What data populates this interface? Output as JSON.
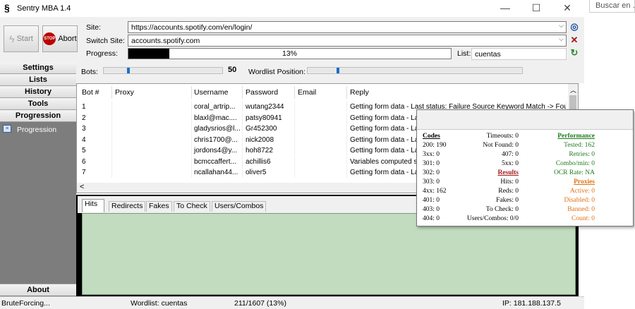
{
  "window": {
    "title": "Sentry MBA 1.4",
    "minimize": "—",
    "maximize": "☐",
    "close": "✕"
  },
  "external": {
    "search_placeholder": "Buscar en ..."
  },
  "toolbar": {
    "start_label": "Start",
    "abort_label": "Abort",
    "stop_badge": "STOP"
  },
  "site": {
    "label": "Site:",
    "value": "https://accounts.spotify.com/en/login/"
  },
  "switch_site": {
    "label": "Switch Site:",
    "value": "accounts.spotify.com"
  },
  "progress": {
    "label": "Progress:",
    "percent": 13,
    "text": "13%"
  },
  "list": {
    "label": "List:",
    "value": "cuentas"
  },
  "nav": {
    "items": [
      "Settings",
      "Lists",
      "History",
      "Tools",
      "Progression"
    ],
    "sub_item": "Progression",
    "about": "About"
  },
  "bots": {
    "label": "Bots:",
    "value": "50",
    "wordlist_label": "Wordlist Position:"
  },
  "table": {
    "headers": [
      "Bot #",
      "Proxy",
      "Username",
      "Password",
      "Email",
      "Reply"
    ],
    "rows": [
      [
        "1",
        "",
        "coral_artrip...",
        "wutang2344",
        "",
        "Getting form data - Last status: Failure Source Keyword Match -> Foun"
      ],
      [
        "2",
        "",
        "blaxl@mac....",
        "patsy80941",
        "",
        "Getting form data - La"
      ],
      [
        "3",
        "",
        "gladysrios@l...",
        "Gr452300",
        "",
        "Getting form data - La"
      ],
      [
        "4",
        "",
        "chris1700@...",
        "nick2008",
        "",
        "Getting form data - La"
      ],
      [
        "5",
        "",
        "jordons4@y...",
        "hoh8722",
        "",
        "Getting form data - La"
      ],
      [
        "6",
        "",
        "bcmccaffert...",
        "achillis6",
        "",
        "Variables computed s"
      ],
      [
        "7",
        "",
        "ncallahan44...",
        "oliver5",
        "",
        "Getting form data - La"
      ]
    ]
  },
  "tabs": [
    "Hits",
    "Redirects",
    "Fakes",
    "To Check",
    "Users/Combos"
  ],
  "status": {
    "state": "BruteForcing...",
    "wordlist": "Wordlist: cuentas",
    "count": "211/1607 (13%)",
    "ip": "IP: 181.188.137.5"
  },
  "popup": {
    "codes_title": "Codes",
    "codes": [
      "200: 190",
      "3xx: 0",
      "301: 0",
      "302: 0",
      "303: 0",
      "4xx: 162",
      "401: 0",
      "403: 0",
      "404: 0"
    ],
    "mid_top": [
      "Timeouts: 0",
      "Not Found: 0",
      "407: 0",
      "5xx: 0"
    ],
    "results_title": "Results",
    "results": [
      "Hits: 0",
      "Reds: 0",
      "Fakes: 0",
      "To Check: 0",
      "Users/Combos: 0/0"
    ],
    "performance_title": "Performance",
    "performance": [
      "Tested: 162",
      "Retries: 0",
      "Combo/min: 0",
      "OCR Rate: NA"
    ],
    "proxies_title": "Proxies",
    "proxies": [
      "Active: 0",
      "Disabled: 0",
      "Banned: 0",
      "Count: 0"
    ]
  },
  "colors": {
    "progress_fill": "#000000",
    "hits_bg": "#c2dcc0",
    "nav_bg": "#7d7d7d",
    "slider_thumb": "#1a6fc9"
  }
}
